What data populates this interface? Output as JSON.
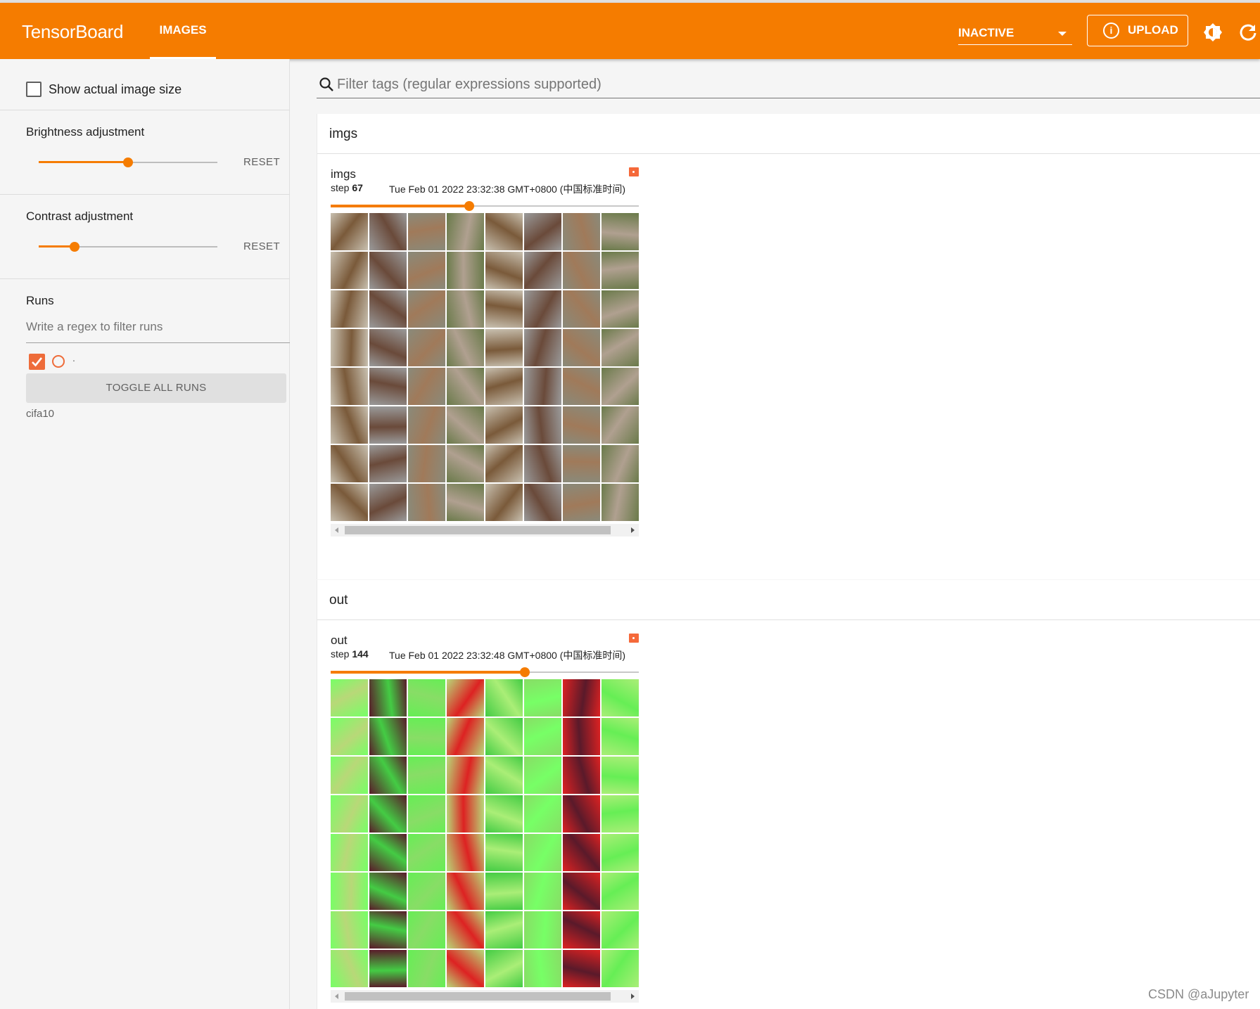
{
  "header": {
    "brand": "TensorBoard",
    "active_tab": "IMAGES",
    "status_select": "INACTIVE",
    "upload_label": "UPLOAD",
    "accent_color": "#f57c00"
  },
  "sidebar": {
    "show_actual_size_label": "Show actual image size",
    "show_actual_size_checked": false,
    "brightness": {
      "label": "Brightness adjustment",
      "reset_label": "RESET",
      "value": 0.5
    },
    "contrast": {
      "label": "Contrast adjustment",
      "reset_label": "RESET",
      "value": 0.2
    },
    "runs": {
      "title": "Runs",
      "filter_placeholder": "Write a regex to filter runs",
      "run_dot": ".",
      "toggle_all_label": "TOGGLE ALL RUNS",
      "run_name": "cifa10",
      "run_checked": true
    }
  },
  "main": {
    "filter_placeholder": "Filter tags (regular expressions supported)",
    "groups": [
      {
        "name": "imgs",
        "card": {
          "tag": "imgs",
          "step_label": "step",
          "step": "67",
          "time": "Tue Feb 01 2022 23:32:38 GMT+0800 (中国标准时间)",
          "slider_value": 0.45
        }
      },
      {
        "name": "out",
        "card": {
          "tag": "out",
          "step_label": "step",
          "step": "144",
          "time": "Tue Feb 01 2022 23:32:48 GMT+0800 (中国标准时间)",
          "slider_value": 0.63
        }
      }
    ]
  },
  "watermark": "CSDN @aJupyter",
  "icons": [
    "info-icon",
    "brightness-icon",
    "refresh-icon",
    "search-icon",
    "checkmark-icon",
    "chevron-down-icon"
  ]
}
